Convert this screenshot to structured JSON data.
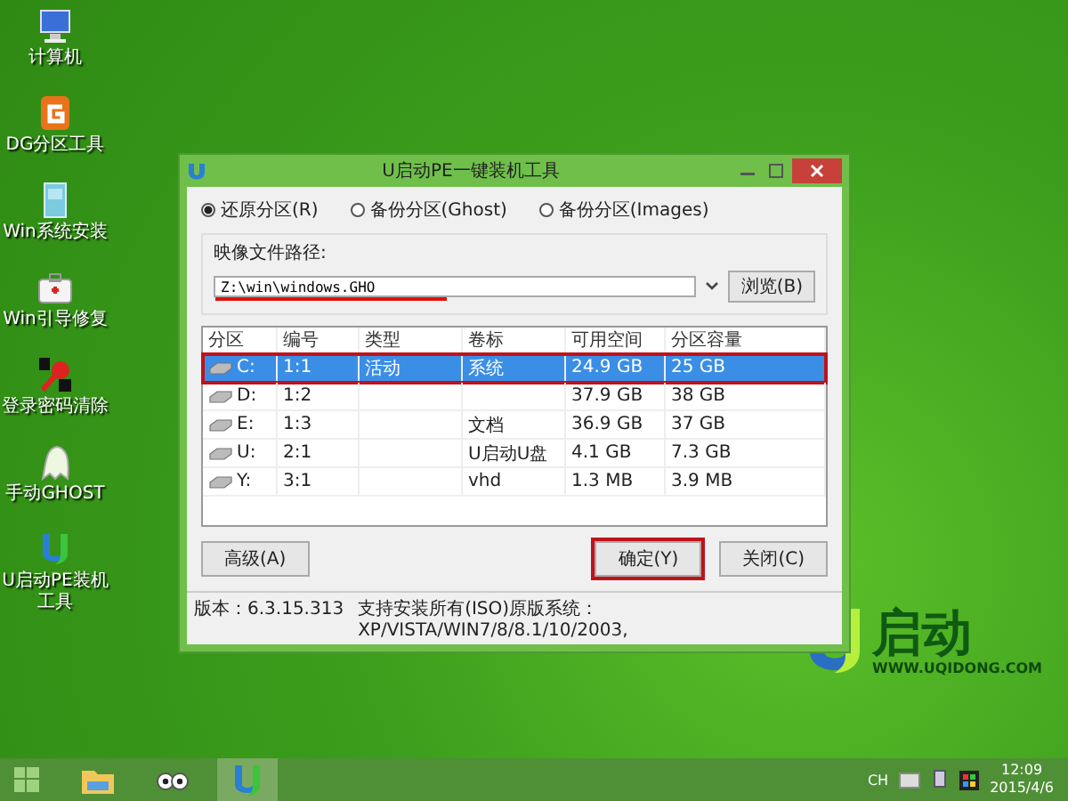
{
  "desktop_icons": [
    {
      "label": "计算机",
      "kind": "computer"
    },
    {
      "label": "DG分区工具",
      "kind": "dg"
    },
    {
      "label": "Win系统安装",
      "kind": "doc"
    },
    {
      "label": "Win引导修复",
      "kind": "kit"
    },
    {
      "label": "登录密码清除",
      "kind": "key"
    },
    {
      "label": "手动GHOST",
      "kind": "ghost"
    },
    {
      "label": "U启动PE装机工具",
      "kind": "u"
    }
  ],
  "window": {
    "title": "U启动PE一键装机工具",
    "modes": [
      {
        "label": "还原分区(R)",
        "selected": true
      },
      {
        "label": "备份分区(Ghost)",
        "selected": false
      },
      {
        "label": "备份分区(Images)",
        "selected": false
      }
    ],
    "image_path": {
      "label": "映像文件路径:",
      "value": "Z:\\win\\windows.GHO",
      "browse": "浏览(B)"
    },
    "table": {
      "columns": [
        "分区",
        "编号",
        "类型",
        "卷标",
        "可用空间",
        "分区容量"
      ],
      "rows": [
        {
          "cells": [
            "C:",
            "1:1",
            "活动",
            "系统",
            "24.9 GB",
            "25 GB"
          ],
          "selected": true
        },
        {
          "cells": [
            "D:",
            "1:2",
            "",
            "",
            "37.9 GB",
            "38 GB"
          ],
          "selected": false
        },
        {
          "cells": [
            "E:",
            "1:3",
            "",
            "文档",
            "36.9 GB",
            "37 GB"
          ],
          "selected": false
        },
        {
          "cells": [
            "U:",
            "2:1",
            "",
            "U启动U盘",
            "4.1 GB",
            "7.3 GB"
          ],
          "selected": false
        },
        {
          "cells": [
            "Y:",
            "3:1",
            "",
            "vhd",
            "1.3 MB",
            "3.9 MB"
          ],
          "selected": false
        }
      ]
    },
    "buttons": [
      {
        "label": "高级(A)",
        "highlighted": false
      },
      {
        "label": "确定(Y)",
        "highlighted": true
      },
      {
        "label": "关闭(C)",
        "highlighted": false
      }
    ],
    "status_bar": {
      "version": "版本：6.3.15.313",
      "support": "支持安装所有(ISO)原版系统：XP/VISTA/WIN7/8/8.1/10/2003,"
    }
  },
  "wallpaper_logo": {
    "brand": "启动",
    "url": "WWW.UQIDONG.COM"
  },
  "taskbar": {
    "apps": [
      {
        "kind": "folder",
        "active": false
      },
      {
        "kind": "eyes",
        "active": false
      },
      {
        "kind": "u",
        "active": true
      }
    ],
    "language": "CH",
    "time": "12:09",
    "date": "2015/4/6"
  }
}
